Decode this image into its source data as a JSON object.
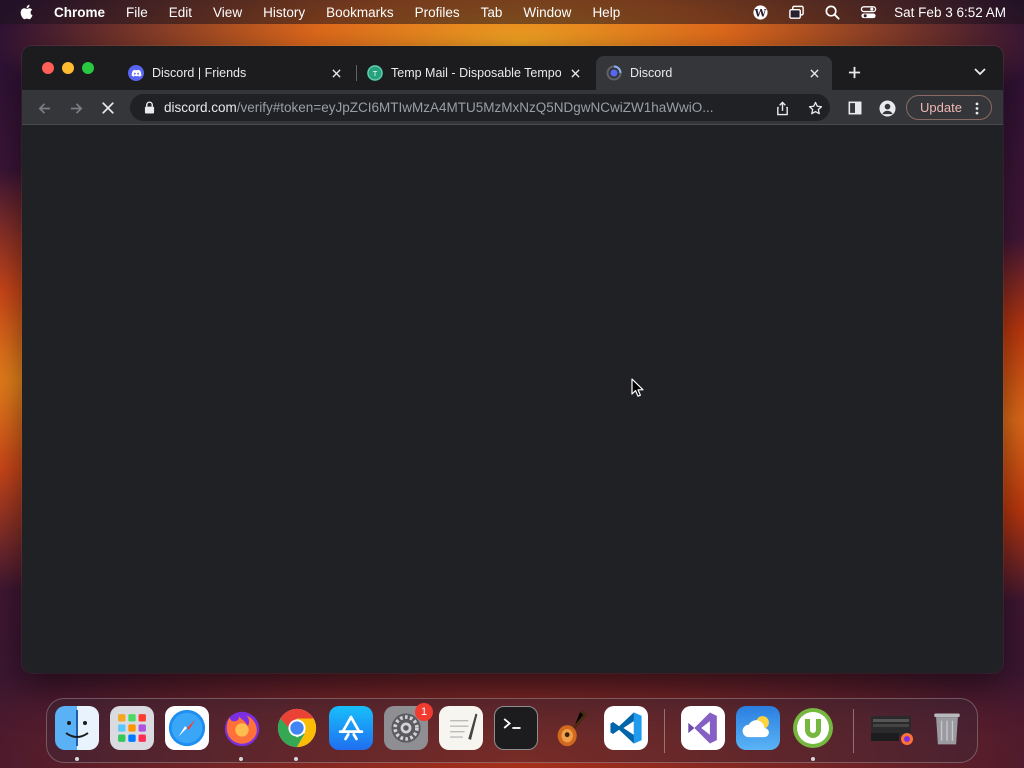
{
  "menubar": {
    "app_name": "Chrome",
    "items": [
      "File",
      "Edit",
      "View",
      "History",
      "Bookmarks",
      "Profiles",
      "Tab",
      "Window",
      "Help"
    ],
    "clock": "Sat Feb 3  6:52 AM"
  },
  "tabs": [
    {
      "title": "Discord | Friends",
      "favicon": "discord-icon",
      "active": false
    },
    {
      "title": "Temp Mail - Disposable Tempo",
      "favicon": "tempmail-icon",
      "active": false
    },
    {
      "title": "Discord",
      "favicon": "discord-loading-icon",
      "active": true
    }
  ],
  "toolbar": {
    "url_host": "discord.com",
    "url_path": "/verify#token=eyJpZCI6MTIwMzA4MTU5MzMxNzQ5NDgwNCwiZW1haWwiO...",
    "update_label": "Update"
  },
  "dock": {
    "apps": [
      {
        "name": "finder-icon",
        "running": true
      },
      {
        "name": "launchpad-icon",
        "running": false
      },
      {
        "name": "safari-icon",
        "running": false
      },
      {
        "name": "firefox-icon",
        "running": true
      },
      {
        "name": "chrome-icon",
        "running": true
      },
      {
        "name": "app-store-icon",
        "running": false
      },
      {
        "name": "system-preferences-icon",
        "running": false,
        "badge": "1"
      },
      {
        "name": "textedit-icon",
        "running": false
      },
      {
        "name": "terminal-icon",
        "running": false
      },
      {
        "name": "garageband-icon",
        "running": false
      },
      {
        "name": "vscode-icon",
        "running": false
      },
      {
        "name": "visual-studio-icon",
        "running": false
      },
      {
        "name": "weather-icon",
        "running": false
      },
      {
        "name": "utorrent-icon",
        "running": true
      },
      {
        "name": "downloads-stack-icon",
        "running": false
      },
      {
        "name": "trash-icon",
        "running": false
      }
    ]
  },
  "colors": {
    "window_bg": "#202124",
    "toolbar_bg": "#35363a",
    "update_text": "#f2b8b5",
    "discord_blurple": "#5865f2"
  }
}
